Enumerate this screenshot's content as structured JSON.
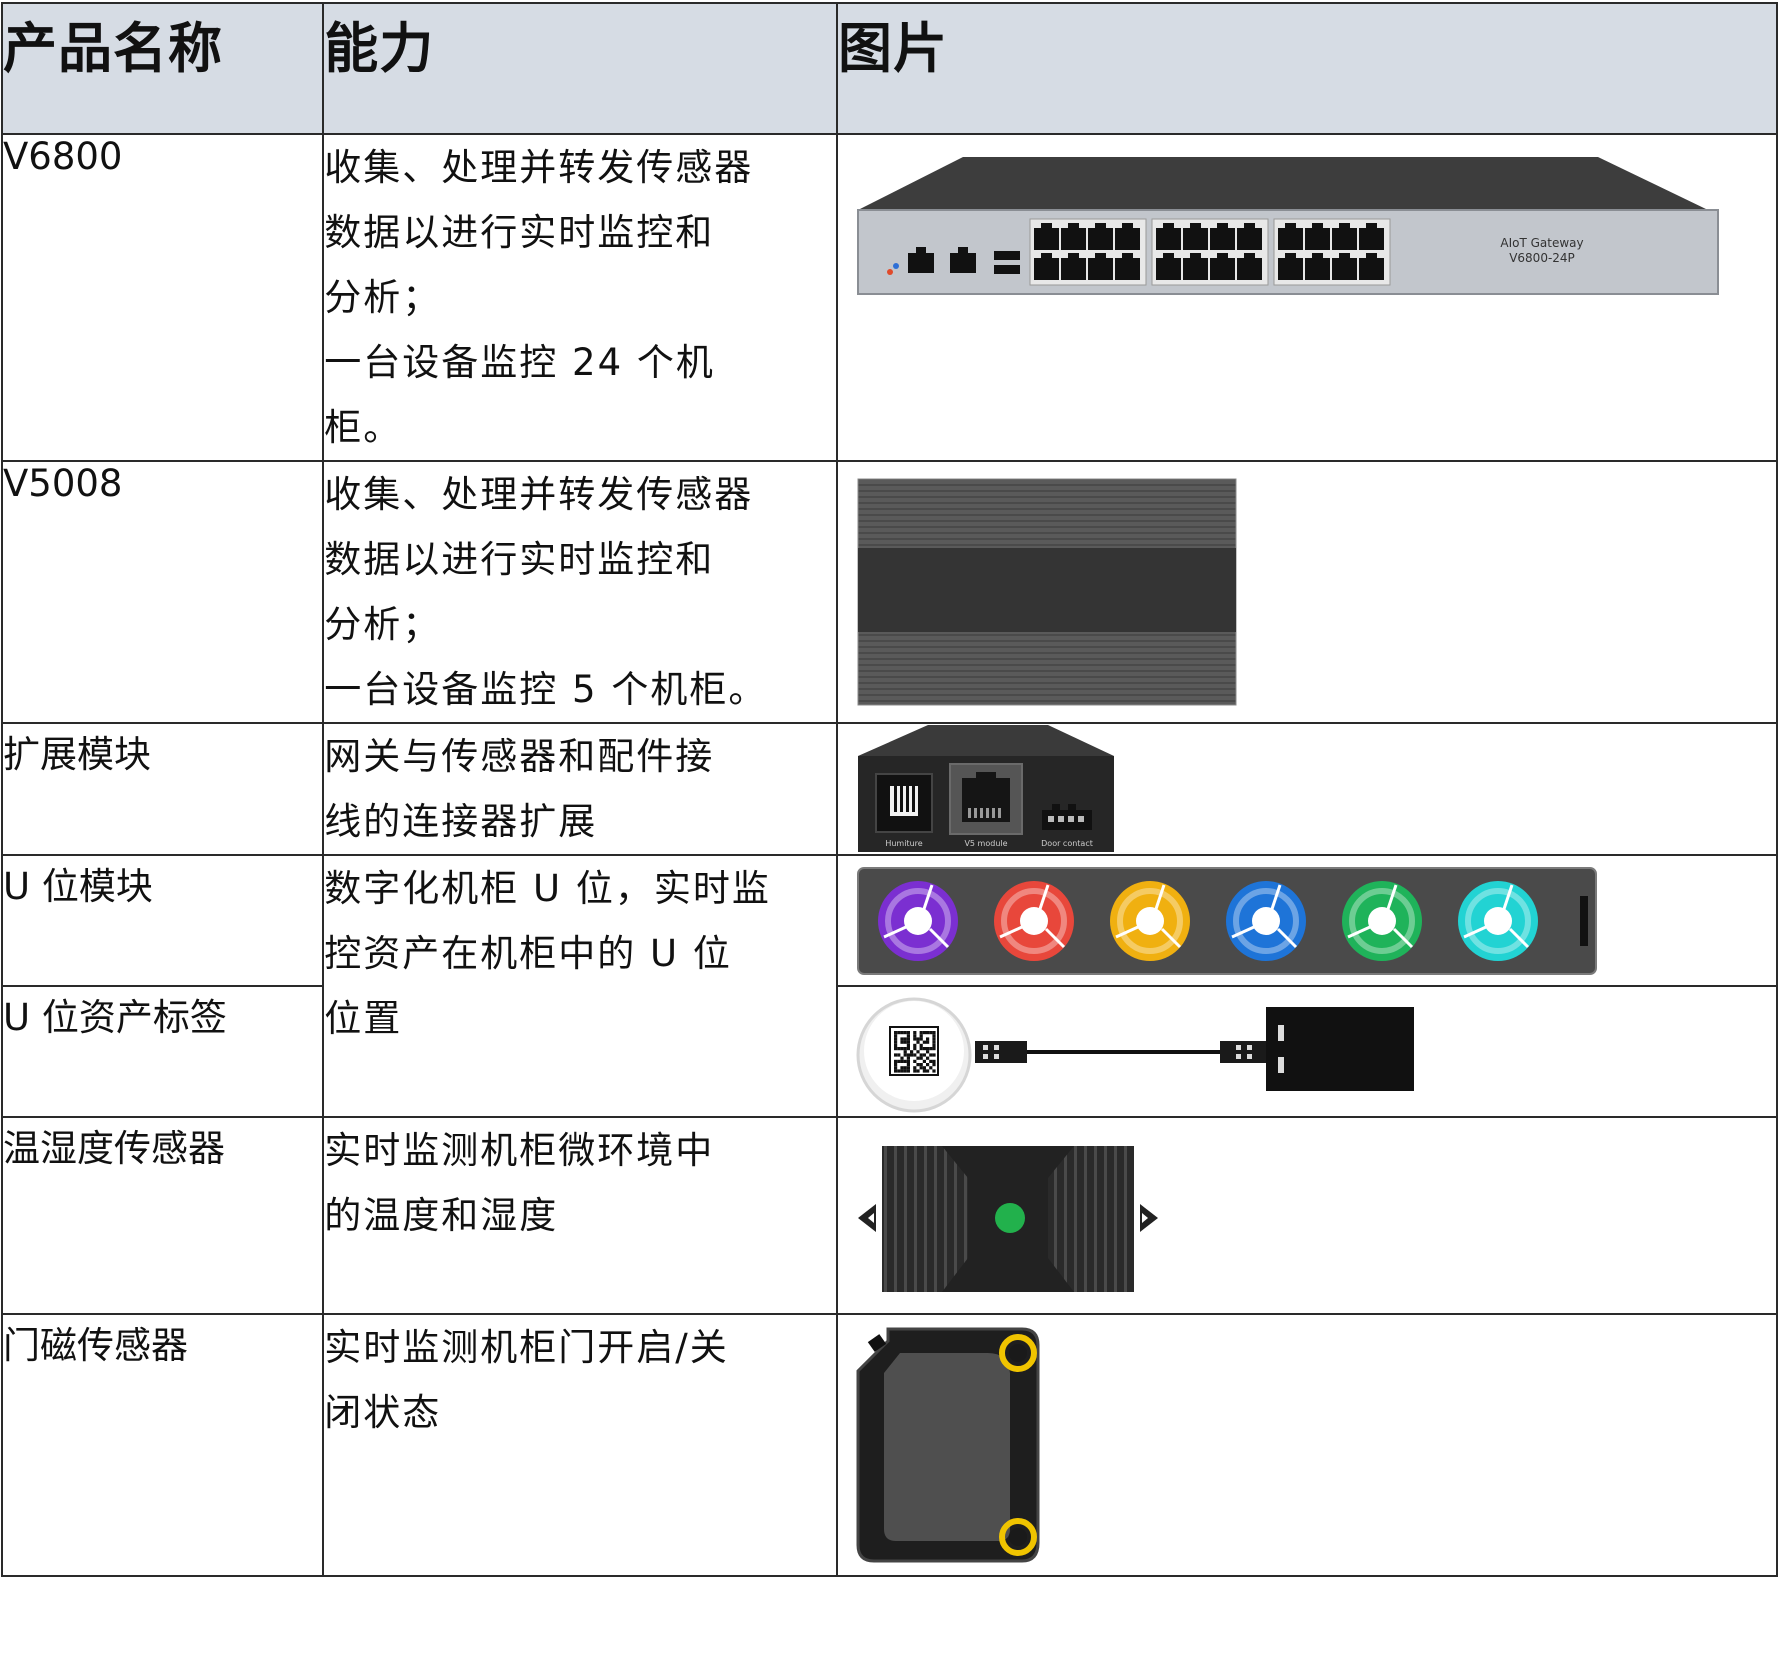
{
  "headers": [
    "产品名称",
    "能力",
    "图片"
  ],
  "rows": [
    {
      "name": "V6800",
      "desc_lines": [
        "收集、处理并转发传感器",
        "数据以进行实时监控和",
        "分析；",
        "一台设备监控 24 个机",
        "柜。"
      ]
    },
    {
      "name": "V5008",
      "desc_lines": [
        "收集、处理并转发传感器",
        "数据以进行实时监控和",
        "分析；",
        "一台设备监控 5 个机柜。"
      ]
    },
    {
      "name": "扩展模块",
      "desc_lines": [
        "网关与传感器和配件接",
        "线的连接器扩展"
      ]
    },
    {
      "name": "U 位模块",
      "desc_lines": [
        "数字化机柜 U 位，实时监",
        "控资产在机柜中的 U 位",
        "位置"
      ]
    },
    {
      "name": "U 位资产标签"
    },
    {
      "name": "温湿度传感器",
      "desc_lines": [
        "实时监测机柜微环境中",
        "的温度和湿度"
      ]
    },
    {
      "name": "门磁传感器",
      "desc_lines": [
        "实时监测机柜门开启/关",
        "闭状态"
      ]
    }
  ],
  "gateway_label": [
    "AIoT Gateway",
    "V6800-24P"
  ],
  "expansion_labels": [
    "Humiture",
    "V5 module",
    "Door contact"
  ],
  "u_module_colors": [
    "#7b2fd1",
    "#e8473b",
    "#f0b010",
    "#1e74d8",
    "#1fb35a",
    "#22d3d3"
  ],
  "temp_led_color": "#22b14c",
  "door_ring_color": "#f0c400"
}
